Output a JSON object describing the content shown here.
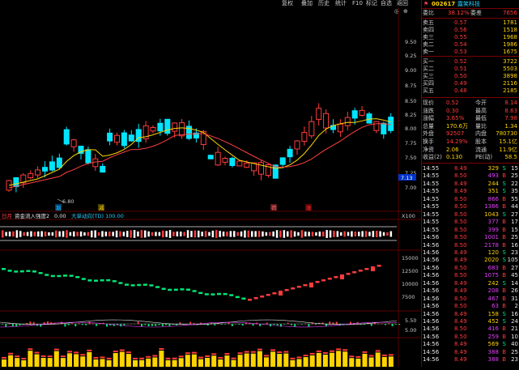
{
  "toolbar": {
    "items": [
      "复权",
      "叠加",
      "历史",
      "统计",
      "F10",
      "标记",
      "自选",
      "返回"
    ],
    "right_icons": [
      "◎",
      "⊕"
    ]
  },
  "stock": {
    "code": "002617",
    "name": "露笑科技",
    "icon": "flag-icon"
  },
  "orderbook": {
    "weibi": {
      "label": "委比",
      "value": "38.12%",
      "label2": "委差",
      "value2": "7656"
    },
    "asks": [
      {
        "label": "卖五",
        "price": "0.57",
        "vol": "1781"
      },
      {
        "label": "卖四",
        "price": "0.56",
        "vol": "1518"
      },
      {
        "label": "卖三",
        "price": "0.55",
        "vol": "1968"
      },
      {
        "label": "卖二",
        "price": "0.54",
        "vol": "1986"
      },
      {
        "label": "卖一",
        "price": "0.53",
        "vol": "1675"
      }
    ],
    "bids": [
      {
        "label": "买一",
        "price": "0.52",
        "vol": "3722"
      },
      {
        "label": "买二",
        "price": "0.51",
        "vol": "5503"
      },
      {
        "label": "买三",
        "price": "0.50",
        "vol": "3898"
      },
      {
        "label": "买四",
        "price": "0.49",
        "vol": "2116"
      },
      {
        "label": "买五",
        "price": "0.48",
        "vol": "2185"
      }
    ]
  },
  "quote": [
    {
      "l1": "现价",
      "v1": "0.52",
      "l2": "今开",
      "v2": "8.14"
    },
    {
      "l1": "涨跌",
      "v1": "0.30",
      "l2": "最高",
      "v2": "8.63"
    },
    {
      "l1": "涨幅",
      "v1": "3.65%",
      "l2": "最低",
      "v2": "7.98"
    },
    {
      "l1": "总量",
      "v1": "170.6万",
      "l2": "量比",
      "v2": "1.34"
    },
    {
      "l1": "外盘",
      "v1": "92507",
      "l2": "内盘",
      "v2": "780730"
    },
    {
      "l1": "换手",
      "v1": "14.29%",
      "l2": "股本",
      "v2": "15.1亿"
    },
    {
      "l1": "净资",
      "v1": "2.06",
      "l2": "流通",
      "v2": "11.9亿"
    },
    {
      "l1": "收益(2)",
      "v1": "0.130",
      "l2": "PE(动)",
      "v2": "58.5"
    }
  ],
  "ticks": [
    {
      "t": "14:55",
      "p": "8.49",
      "v": "329",
      "s": "S",
      "n": "15"
    },
    {
      "t": "14:55",
      "p": "8.50",
      "v": "493",
      "s": "B",
      "n": "25"
    },
    {
      "t": "14:55",
      "p": "8.49",
      "v": "244",
      "s": "S",
      "n": "22"
    },
    {
      "t": "14:55",
      "p": "8.49",
      "v": "351",
      "s": "S",
      "n": "35"
    },
    {
      "t": "14:55",
      "p": "8.50",
      "v": "866",
      "s": "B",
      "n": "55"
    },
    {
      "t": "14:55",
      "p": "8.50",
      "v": "1386",
      "s": "B",
      "n": "44"
    },
    {
      "t": "14:55",
      "p": "8.50",
      "v": "1043",
      "s": "S",
      "n": "27"
    },
    {
      "t": "14:55",
      "p": "8.50",
      "v": "377",
      "s": "B",
      "n": "17"
    },
    {
      "t": "14:55",
      "p": "8.50",
      "v": "399",
      "s": "B",
      "n": "15"
    },
    {
      "t": "14:56",
      "p": "8.50",
      "v": "1001",
      "s": "B",
      "n": "25"
    },
    {
      "t": "14:56",
      "p": "8.50",
      "v": "2178",
      "s": "B",
      "n": "16"
    },
    {
      "t": "14:56",
      "p": "8.49",
      "v": "120",
      "s": "S",
      "n": "23"
    },
    {
      "t": "14:56",
      "p": "8.49",
      "v": "2020",
      "s": "S",
      "n": "105"
    },
    {
      "t": "14:56",
      "p": "8.50",
      "v": "683",
      "s": "B",
      "n": "27"
    },
    {
      "t": "14:56",
      "p": "8.50",
      "v": "1075",
      "s": "B",
      "n": "45"
    },
    {
      "t": "14:56",
      "p": "8.49",
      "v": "242",
      "s": "S",
      "n": "14"
    },
    {
      "t": "14:56",
      "p": "8.49",
      "v": "208",
      "s": "B",
      "n": "26"
    },
    {
      "t": "14:56",
      "p": "8.50",
      "v": "467",
      "s": "B",
      "n": "31"
    },
    {
      "t": "14:56",
      "p": "8.50",
      "v": "63",
      "s": "B",
      "n": "2"
    },
    {
      "t": "14:56",
      "p": "8.49",
      "v": "158",
      "s": "S",
      "n": "16"
    },
    {
      "t": "14:56",
      "p": "8.49",
      "v": "452",
      "s": "S",
      "n": "24"
    },
    {
      "t": "14:56",
      "p": "8.50",
      "v": "416",
      "s": "B",
      "n": "21"
    },
    {
      "t": "14:56",
      "p": "8.50",
      "v": "259",
      "s": "B",
      "n": "10"
    },
    {
      "t": "14:56",
      "p": "8.49",
      "v": "569",
      "s": "S",
      "n": "40"
    },
    {
      "t": "14:56",
      "p": "8.49",
      "v": "388",
      "s": "B",
      "n": "25"
    },
    {
      "t": "14:56",
      "p": "8.49",
      "v": "388",
      "s": "B",
      "n": "23"
    }
  ],
  "price_axis": [
    "8.50",
    "8.25",
    "8.00",
    "7.75",
    "7.50",
    "7.25",
    "7.00"
  ],
  "price_axis_top": [
    "9.50",
    "9.25",
    "9.00",
    "8.75"
  ],
  "low_label": "6.80",
  "current_price_tag": "7.13",
  "signal_labels": [
    {
      "text": "割",
      "color": "#1fd1ff"
    },
    {
      "text": "减",
      "color": "#ffd400"
    },
    {
      "text": "荷",
      "color": "#ff6a6a"
    },
    {
      "text": "涨",
      "color": "#ff3b3b"
    }
  ],
  "indicator_header": {
    "prefix": "日月",
    "name": "资金流入强度2",
    "value": "0.00",
    "extra": "大单动向(TD) 100.00",
    "scale": "X100"
  },
  "vol_axis": [
    "15000",
    "12500",
    "10000",
    "7500"
  ],
  "mid_axis": [
    "5.50",
    "5.00"
  ],
  "colors": {
    "up": "#ff3b3b",
    "down": "#00e5ff",
    "ma1": "#ffd400",
    "ma2": "#ff4040",
    "accent": "#ff0000"
  }
}
